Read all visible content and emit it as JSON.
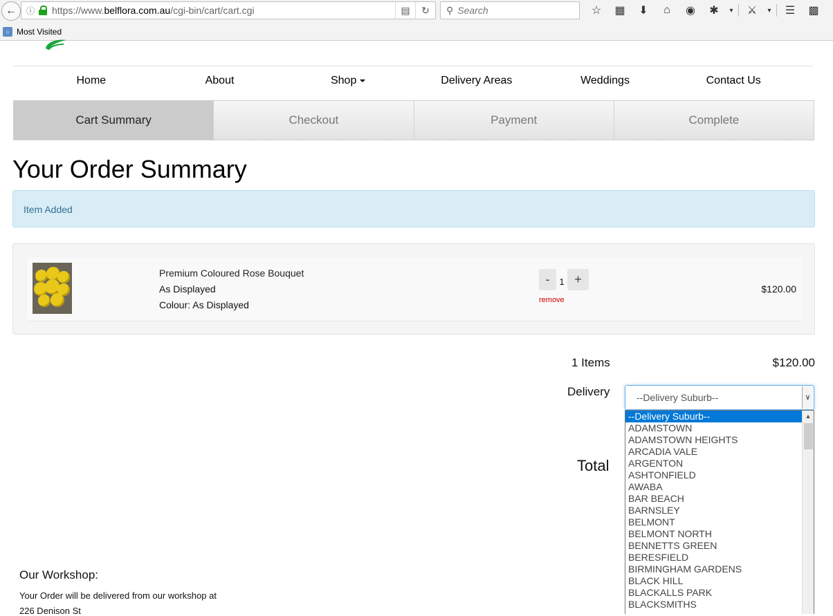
{
  "browser": {
    "url_prefix": "https://www.",
    "url_domain": "belflora.com.au",
    "url_path": "/cgi-bin/cart/cart.cgi",
    "search_placeholder": "Search",
    "bookmark_label": "Most Visited"
  },
  "nav": {
    "items": [
      "Home",
      "About",
      "Shop",
      "Delivery Areas",
      "Weddings",
      "Contact Us"
    ]
  },
  "steps": [
    "Cart Summary",
    "Checkout",
    "Payment",
    "Complete"
  ],
  "page": {
    "title": "Your Order Summary",
    "alert": "Item Added"
  },
  "cart": {
    "item": {
      "name": "Premium Coloured Rose Bouquet",
      "option1": "As Displayed",
      "option2": "Colour: As Displayed",
      "quantity": "1",
      "minus": "-",
      "plus": "+",
      "remove": "remove",
      "price": "$120.00"
    }
  },
  "summary": {
    "items_count": "1 Items",
    "items_total": "$120.00",
    "delivery_label": "Delivery",
    "total_label": "Total"
  },
  "delivery_select": {
    "value": "--Delivery Suburb--",
    "options": [
      "--Delivery Suburb--",
      "ADAMSTOWN",
      "ADAMSTOWN HEIGHTS",
      "ARCADIA VALE",
      "ARGENTON",
      "ASHTONFIELD",
      "AWABA",
      "BAR BEACH",
      "BARNSLEY",
      "BELMONT",
      "BELMONT NORTH",
      "BENNETTS GREEN",
      "BERESFIELD",
      "BIRMINGHAM GARDENS",
      "BLACK HILL",
      "BLACKALLS PARK",
      "BLACKSMITHS"
    ]
  },
  "workshop": {
    "title": "Our Workshop:",
    "text": "Your Order will be delivered from our workshop at",
    "address": "226 Denison St"
  },
  "colors": {
    "alert_bg": "#d9edf7",
    "alert_text": "#31708f",
    "select_focus": "#66afe9",
    "dropdown_selected": "#0078d7",
    "remove_link": "#cc0000"
  }
}
